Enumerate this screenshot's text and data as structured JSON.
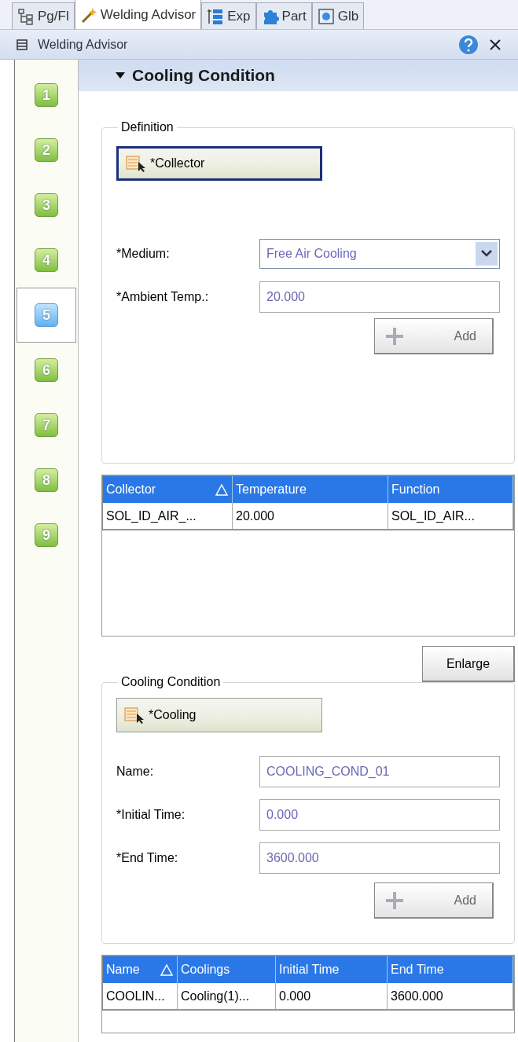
{
  "tabs": [
    {
      "label": "Pg/Fl",
      "selected": false
    },
    {
      "label": "Welding Advisor",
      "selected": true
    },
    {
      "label": "Exp",
      "selected": false
    },
    {
      "label": "Part",
      "selected": false
    },
    {
      "label": "Glb",
      "selected": false
    }
  ],
  "panel": {
    "title": "Welding Advisor"
  },
  "steps": [
    {
      "label": "1",
      "selected": false
    },
    {
      "label": "2",
      "selected": false
    },
    {
      "label": "3",
      "selected": false
    },
    {
      "label": "4",
      "selected": false
    },
    {
      "label": "5",
      "selected": true
    },
    {
      "label": "6",
      "selected": false
    },
    {
      "label": "7",
      "selected": false
    },
    {
      "label": "8",
      "selected": false
    },
    {
      "label": "9",
      "selected": false
    }
  ],
  "section": {
    "title": "Cooling Condition",
    "expanded": true
  },
  "definition": {
    "legend": "Definition",
    "select_button": "*Collector",
    "focused": true,
    "fields": [
      {
        "kind": "dropdown",
        "label": "*Medium:",
        "value": "Free Air Cooling"
      },
      {
        "kind": "text",
        "label": "*Ambient Temp.:",
        "value": "20.000"
      }
    ],
    "add_button": "Add"
  },
  "collector_table": {
    "columns": [
      {
        "label": "Collector",
        "sorted": true
      },
      {
        "label": "Temperature",
        "sorted": false
      },
      {
        "label": "Function",
        "sorted": false
      }
    ],
    "rows": [
      [
        "SOL_ID_AIR_...",
        "20.000",
        "SOL_ID_AIR..."
      ]
    ]
  },
  "enlarge_button": "Enlarge",
  "cooling": {
    "legend": "Cooling Condition",
    "select_button": "*Cooling",
    "focused": false,
    "fields": [
      {
        "kind": "text",
        "label": "Name:",
        "value": "COOLING_COND_01"
      },
      {
        "kind": "text",
        "label": "*Initial Time:",
        "value": "0.000"
      },
      {
        "kind": "text",
        "label": "*End Time:",
        "value": "3600.000"
      }
    ],
    "add_button": "Add"
  },
  "cooling_table": {
    "columns": [
      {
        "label": "Name",
        "sorted": true
      },
      {
        "label": "Coolings",
        "sorted": false
      },
      {
        "label": "Initial Time",
        "sorted": false
      },
      {
        "label": "End Time",
        "sorted": false
      }
    ],
    "rows": [
      [
        "COOLIN...",
        "Cooling(1)...",
        "0.000",
        "3600.000"
      ]
    ]
  }
}
